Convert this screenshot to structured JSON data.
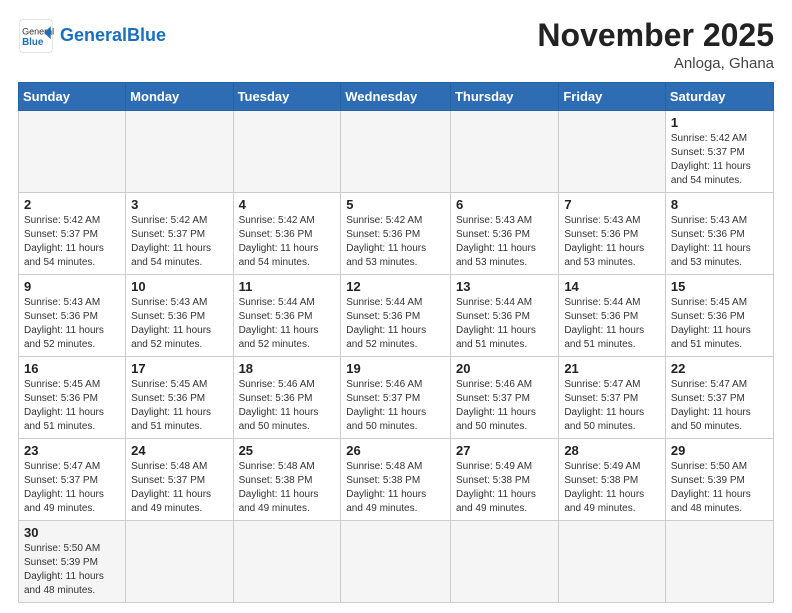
{
  "header": {
    "logo_general": "General",
    "logo_blue": "Blue",
    "month_title": "November 2025",
    "location": "Anloga, Ghana"
  },
  "days_of_week": [
    "Sunday",
    "Monday",
    "Tuesday",
    "Wednesday",
    "Thursday",
    "Friday",
    "Saturday"
  ],
  "weeks": [
    [
      {
        "day": "",
        "sunrise": "",
        "sunset": "",
        "daylight": "",
        "empty": true
      },
      {
        "day": "",
        "sunrise": "",
        "sunset": "",
        "daylight": "",
        "empty": true
      },
      {
        "day": "",
        "sunrise": "",
        "sunset": "",
        "daylight": "",
        "empty": true
      },
      {
        "day": "",
        "sunrise": "",
        "sunset": "",
        "daylight": "",
        "empty": true
      },
      {
        "day": "",
        "sunrise": "",
        "sunset": "",
        "daylight": "",
        "empty": true
      },
      {
        "day": "",
        "sunrise": "",
        "sunset": "",
        "daylight": "",
        "empty": true
      },
      {
        "day": "1",
        "sunrise": "Sunrise: 5:42 AM",
        "sunset": "Sunset: 5:37 PM",
        "daylight": "Daylight: 11 hours and 54 minutes.",
        "empty": false
      }
    ],
    [
      {
        "day": "2",
        "sunrise": "Sunrise: 5:42 AM",
        "sunset": "Sunset: 5:37 PM",
        "daylight": "Daylight: 11 hours and 54 minutes.",
        "empty": false
      },
      {
        "day": "3",
        "sunrise": "Sunrise: 5:42 AM",
        "sunset": "Sunset: 5:37 PM",
        "daylight": "Daylight: 11 hours and 54 minutes.",
        "empty": false
      },
      {
        "day": "4",
        "sunrise": "Sunrise: 5:42 AM",
        "sunset": "Sunset: 5:36 PM",
        "daylight": "Daylight: 11 hours and 54 minutes.",
        "empty": false
      },
      {
        "day": "5",
        "sunrise": "Sunrise: 5:42 AM",
        "sunset": "Sunset: 5:36 PM",
        "daylight": "Daylight: 11 hours and 53 minutes.",
        "empty": false
      },
      {
        "day": "6",
        "sunrise": "Sunrise: 5:43 AM",
        "sunset": "Sunset: 5:36 PM",
        "daylight": "Daylight: 11 hours and 53 minutes.",
        "empty": false
      },
      {
        "day": "7",
        "sunrise": "Sunrise: 5:43 AM",
        "sunset": "Sunset: 5:36 PM",
        "daylight": "Daylight: 11 hours and 53 minutes.",
        "empty": false
      },
      {
        "day": "8",
        "sunrise": "Sunrise: 5:43 AM",
        "sunset": "Sunset: 5:36 PM",
        "daylight": "Daylight: 11 hours and 53 minutes.",
        "empty": false
      }
    ],
    [
      {
        "day": "9",
        "sunrise": "Sunrise: 5:43 AM",
        "sunset": "Sunset: 5:36 PM",
        "daylight": "Daylight: 11 hours and 52 minutes.",
        "empty": false
      },
      {
        "day": "10",
        "sunrise": "Sunrise: 5:43 AM",
        "sunset": "Sunset: 5:36 PM",
        "daylight": "Daylight: 11 hours and 52 minutes.",
        "empty": false
      },
      {
        "day": "11",
        "sunrise": "Sunrise: 5:44 AM",
        "sunset": "Sunset: 5:36 PM",
        "daylight": "Daylight: 11 hours and 52 minutes.",
        "empty": false
      },
      {
        "day": "12",
        "sunrise": "Sunrise: 5:44 AM",
        "sunset": "Sunset: 5:36 PM",
        "daylight": "Daylight: 11 hours and 52 minutes.",
        "empty": false
      },
      {
        "day": "13",
        "sunrise": "Sunrise: 5:44 AM",
        "sunset": "Sunset: 5:36 PM",
        "daylight": "Daylight: 11 hours and 51 minutes.",
        "empty": false
      },
      {
        "day": "14",
        "sunrise": "Sunrise: 5:44 AM",
        "sunset": "Sunset: 5:36 PM",
        "daylight": "Daylight: 11 hours and 51 minutes.",
        "empty": false
      },
      {
        "day": "15",
        "sunrise": "Sunrise: 5:45 AM",
        "sunset": "Sunset: 5:36 PM",
        "daylight": "Daylight: 11 hours and 51 minutes.",
        "empty": false
      }
    ],
    [
      {
        "day": "16",
        "sunrise": "Sunrise: 5:45 AM",
        "sunset": "Sunset: 5:36 PM",
        "daylight": "Daylight: 11 hours and 51 minutes.",
        "empty": false
      },
      {
        "day": "17",
        "sunrise": "Sunrise: 5:45 AM",
        "sunset": "Sunset: 5:36 PM",
        "daylight": "Daylight: 11 hours and 51 minutes.",
        "empty": false
      },
      {
        "day": "18",
        "sunrise": "Sunrise: 5:46 AM",
        "sunset": "Sunset: 5:36 PM",
        "daylight": "Daylight: 11 hours and 50 minutes.",
        "empty": false
      },
      {
        "day": "19",
        "sunrise": "Sunrise: 5:46 AM",
        "sunset": "Sunset: 5:37 PM",
        "daylight": "Daylight: 11 hours and 50 minutes.",
        "empty": false
      },
      {
        "day": "20",
        "sunrise": "Sunrise: 5:46 AM",
        "sunset": "Sunset: 5:37 PM",
        "daylight": "Daylight: 11 hours and 50 minutes.",
        "empty": false
      },
      {
        "day": "21",
        "sunrise": "Sunrise: 5:47 AM",
        "sunset": "Sunset: 5:37 PM",
        "daylight": "Daylight: 11 hours and 50 minutes.",
        "empty": false
      },
      {
        "day": "22",
        "sunrise": "Sunrise: 5:47 AM",
        "sunset": "Sunset: 5:37 PM",
        "daylight": "Daylight: 11 hours and 50 minutes.",
        "empty": false
      }
    ],
    [
      {
        "day": "23",
        "sunrise": "Sunrise: 5:47 AM",
        "sunset": "Sunset: 5:37 PM",
        "daylight": "Daylight: 11 hours and 49 minutes.",
        "empty": false
      },
      {
        "day": "24",
        "sunrise": "Sunrise: 5:48 AM",
        "sunset": "Sunset: 5:37 PM",
        "daylight": "Daylight: 11 hours and 49 minutes.",
        "empty": false
      },
      {
        "day": "25",
        "sunrise": "Sunrise: 5:48 AM",
        "sunset": "Sunset: 5:38 PM",
        "daylight": "Daylight: 11 hours and 49 minutes.",
        "empty": false
      },
      {
        "day": "26",
        "sunrise": "Sunrise: 5:48 AM",
        "sunset": "Sunset: 5:38 PM",
        "daylight": "Daylight: 11 hours and 49 minutes.",
        "empty": false
      },
      {
        "day": "27",
        "sunrise": "Sunrise: 5:49 AM",
        "sunset": "Sunset: 5:38 PM",
        "daylight": "Daylight: 11 hours and 49 minutes.",
        "empty": false
      },
      {
        "day": "28",
        "sunrise": "Sunrise: 5:49 AM",
        "sunset": "Sunset: 5:38 PM",
        "daylight": "Daylight: 11 hours and 49 minutes.",
        "empty": false
      },
      {
        "day": "29",
        "sunrise": "Sunrise: 5:50 AM",
        "sunset": "Sunset: 5:39 PM",
        "daylight": "Daylight: 11 hours and 48 minutes.",
        "empty": false
      }
    ],
    [
      {
        "day": "30",
        "sunrise": "Sunrise: 5:50 AM",
        "sunset": "Sunset: 5:39 PM",
        "daylight": "Daylight: 11 hours and 48 minutes.",
        "empty": false,
        "lastrow": true
      },
      {
        "day": "",
        "sunrise": "",
        "sunset": "",
        "daylight": "",
        "empty": true,
        "lastrow": true
      },
      {
        "day": "",
        "sunrise": "",
        "sunset": "",
        "daylight": "",
        "empty": true,
        "lastrow": true
      },
      {
        "day": "",
        "sunrise": "",
        "sunset": "",
        "daylight": "",
        "empty": true,
        "lastrow": true
      },
      {
        "day": "",
        "sunrise": "",
        "sunset": "",
        "daylight": "",
        "empty": true,
        "lastrow": true
      },
      {
        "day": "",
        "sunrise": "",
        "sunset": "",
        "daylight": "",
        "empty": true,
        "lastrow": true
      },
      {
        "day": "",
        "sunrise": "",
        "sunset": "",
        "daylight": "",
        "empty": true,
        "lastrow": true
      }
    ]
  ]
}
